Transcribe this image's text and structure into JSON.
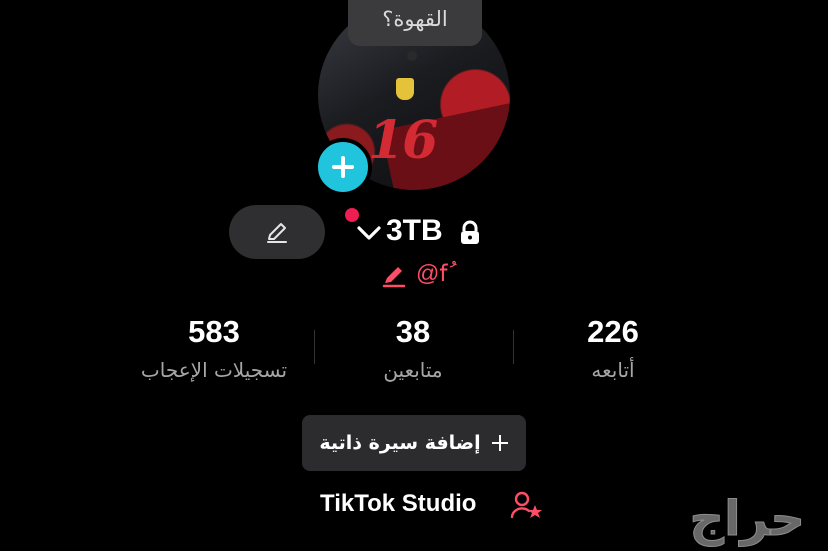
{
  "tooltip": {
    "text": "القهوة؟"
  },
  "profile": {
    "username": "3TB",
    "handle": "@f",
    "handle_mark": "ُ",
    "avatar_number": "16"
  },
  "stats": [
    {
      "value": "583",
      "label": "تسجيلات الإعجاب"
    },
    {
      "value": "38",
      "label": "متابعين"
    },
    {
      "value": "226",
      "label": "أتابعه"
    }
  ],
  "actions": {
    "add_bio": "إضافة سيرة ذاتية",
    "studio": "TikTok Studio"
  },
  "watermark": {
    "text": "حراج"
  },
  "colors": {
    "background": "#000000",
    "accent_cyan": "#21c4dd",
    "accent_red": "#ee1d52",
    "handle": "#ff4d66"
  }
}
